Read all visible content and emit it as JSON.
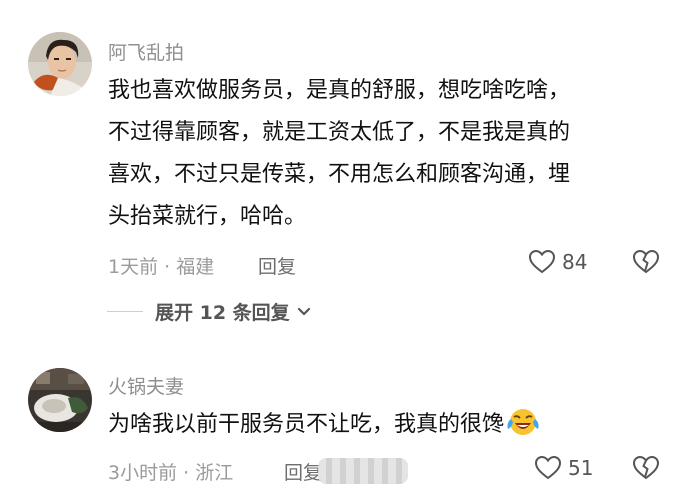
{
  "comments": [
    {
      "author": "阿飞乱拍",
      "lines": [
        "我也喜欢做服务员，是真的舒服，想吃啥吃啥，",
        "不过得靠顾客，就是工资太低了，不是我是真的",
        "喜欢，不过只是传菜，不用怎么和顾客沟通，埋",
        "头抬菜就行，哈哈。"
      ],
      "meta": "1天前 · 福建",
      "reply_label": "回复",
      "likes": "84",
      "expand_label": "展开 12 条回复"
    },
    {
      "author": "火锅夫妻",
      "lines": [
        "为啥我以前干服务员不让吃，我真的很馋"
      ],
      "meta": "3小时前 · 浙江",
      "reply_label": "回复",
      "likes": "51"
    }
  ],
  "colors": {
    "meta": "#9b9b9b",
    "author": "#8f8f8f",
    "text": "#111111"
  },
  "icons": [
    "heart-outline-icon",
    "broken-heart-icon",
    "chevron-down-icon",
    "crying-laughing-emoji"
  ]
}
